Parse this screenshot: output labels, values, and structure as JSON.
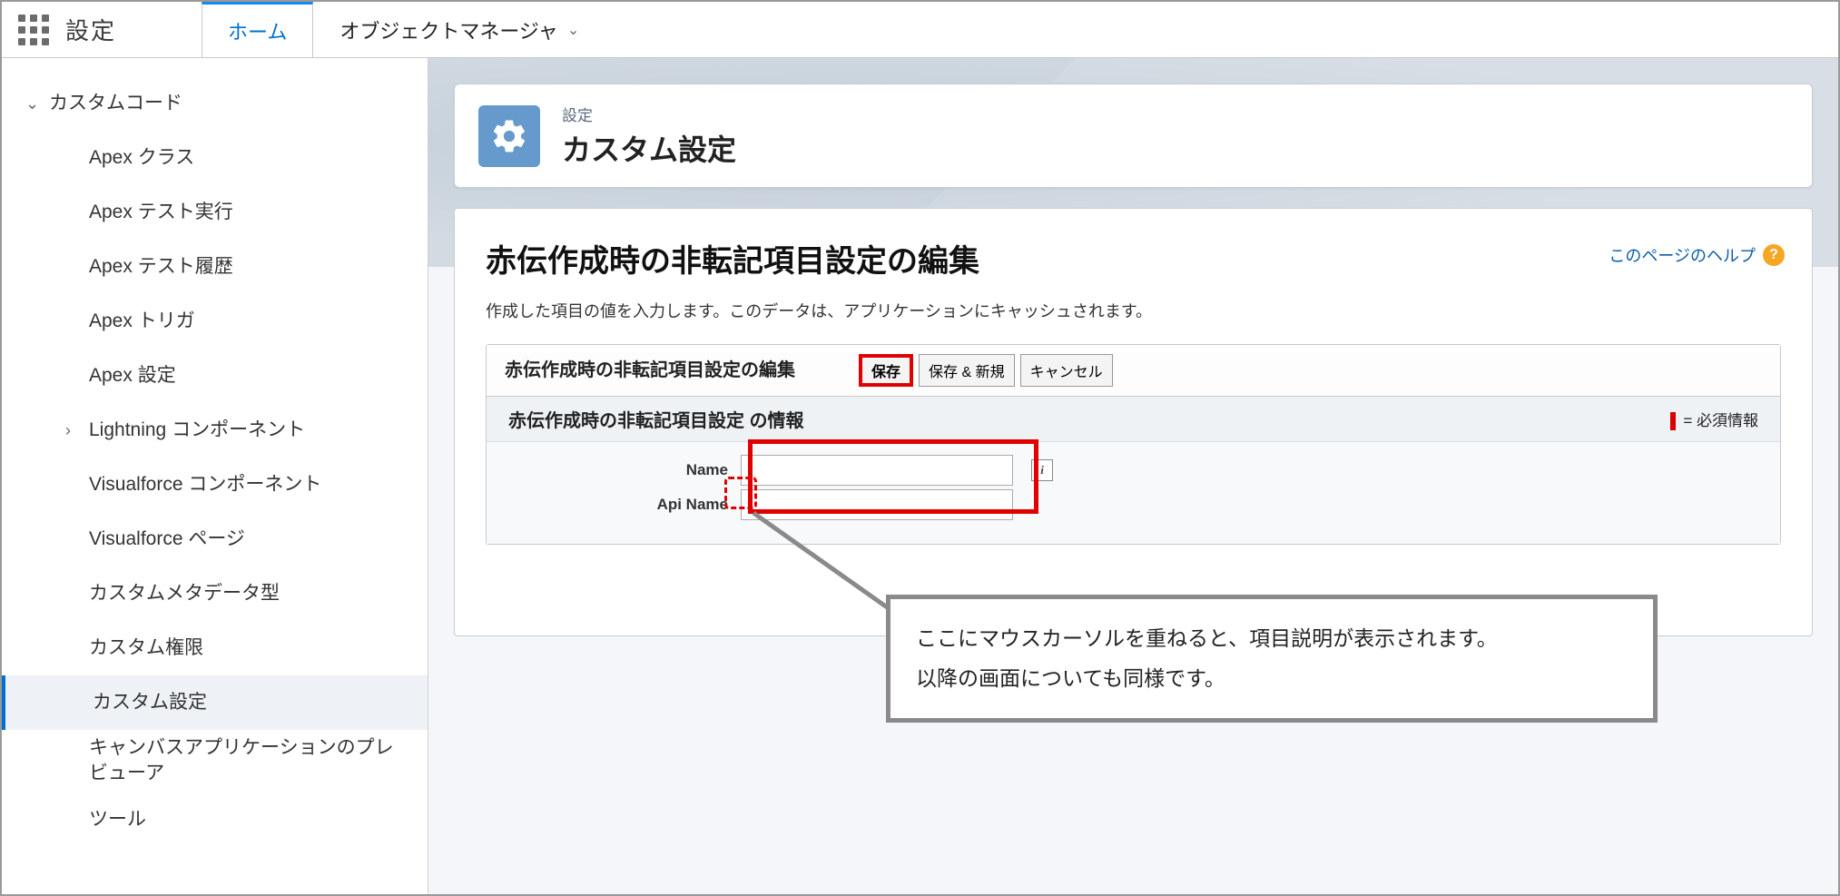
{
  "topbar": {
    "setup_label": "設定",
    "tabs": [
      {
        "label": "ホーム",
        "active": true
      },
      {
        "label": "オブジェクトマネージャ",
        "active": false,
        "hasMenu": true
      }
    ]
  },
  "sidebar": {
    "root": "カスタムコード",
    "items": [
      {
        "label": "Apex クラス",
        "level": 1
      },
      {
        "label": "Apex テスト実行",
        "level": 1
      },
      {
        "label": "Apex テスト履歴",
        "level": 1
      },
      {
        "label": "Apex トリガ",
        "level": 1
      },
      {
        "label": "Apex 設定",
        "level": 1
      },
      {
        "label": "Lightning コンポーネント",
        "level": 1,
        "caret": ">"
      },
      {
        "label": "Visualforce コンポーネント",
        "level": 1
      },
      {
        "label": "Visualforce ページ",
        "level": 1
      },
      {
        "label": "カスタムメタデータ型",
        "level": 1
      },
      {
        "label": "カスタム権限",
        "level": 1
      },
      {
        "label": "カスタム設定",
        "level": 1,
        "selected": true
      },
      {
        "label": "キャンバスアプリケーションのプレビューア",
        "level": 1
      },
      {
        "label": "ツール",
        "level": 1
      }
    ]
  },
  "header": {
    "crumb": "設定",
    "title": "カスタム設定"
  },
  "page": {
    "title": "赤伝作成時の非転記項目設定の編集",
    "help_link": "このページのヘルプ",
    "description": "作成した項目の値を入力します。このデータは、アプリケーションにキャッシュされます。",
    "edit_block_title": "赤伝作成時の非転記項目設定の編集",
    "buttons": {
      "save": "保存",
      "save_new": "保存 & 新規",
      "cancel": "キャンセル"
    },
    "section_title": "赤伝作成時の非転記項目設定 の情報",
    "required_note": "= 必須情報",
    "fields": {
      "name_label": "Name",
      "name_value": "",
      "api_label": "Api Name",
      "api_value": ""
    },
    "info_icon": "i",
    "annotation_line1": "ここにマウスカーソルを重ねると、項目説明が表示されます。",
    "annotation_line2": "以降の画面についても同様です。"
  }
}
